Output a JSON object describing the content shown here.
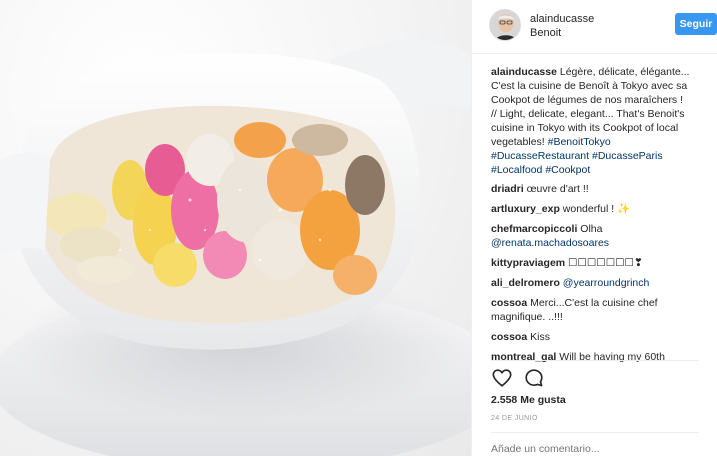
{
  "header": {
    "username": "alainducasse",
    "location": "Benoit",
    "follow_label": "Seguir"
  },
  "caption": {
    "username": "alainducasse",
    "lines": [
      "Légère, délicate, élégante...",
      "C'est la cuisine de Benoît à Tokyo avec sa",
      "Cookpot de légumes de nos maraîchers !",
      "// Light, delicate, elegant... That's Benoit's",
      "cuisine in Tokyo with its Cookpot of local",
      "vegetables! "
    ],
    "tags_line1": [
      "#BenoitTokyo"
    ],
    "tags_line2": [
      "#DucasseRestaurant",
      "#DucasseParis"
    ],
    "tags_line3": [
      "#Localfood",
      "#Cookpot"
    ]
  },
  "comments": [
    {
      "user": "driadri",
      "text": "œuvre d'art !!"
    },
    {
      "user": "artluxury_exp",
      "text": "wonderful ! ✨"
    },
    {
      "user": "chefmarcopiccoli",
      "text": "Olha",
      "mention": "@renata.machadosoares"
    },
    {
      "user": "kittypraviagem",
      "text": "☐☐☐☐☐☐☐❣"
    },
    {
      "user": "ali_delromero",
      "mention": "@yearroundgrinch"
    },
    {
      "user": "cossoa",
      "text": "Merci...C'est la cuisine chef",
      "text2": "magnifique. ..!!!"
    },
    {
      "user": "cossoa",
      "text": "Kiss"
    },
    {
      "user": "montreal_gal",
      "text": "Will be having my 60th"
    }
  ],
  "likes": "2.558 Me gusta",
  "date": "24 DE JUNIO",
  "add_comment_placeholder": "Añade un comentario...",
  "colors": {
    "accent": "#3897f0",
    "hashtag": "#003569",
    "muted": "#999999"
  },
  "icons": [
    "heart-icon",
    "comment-icon"
  ]
}
